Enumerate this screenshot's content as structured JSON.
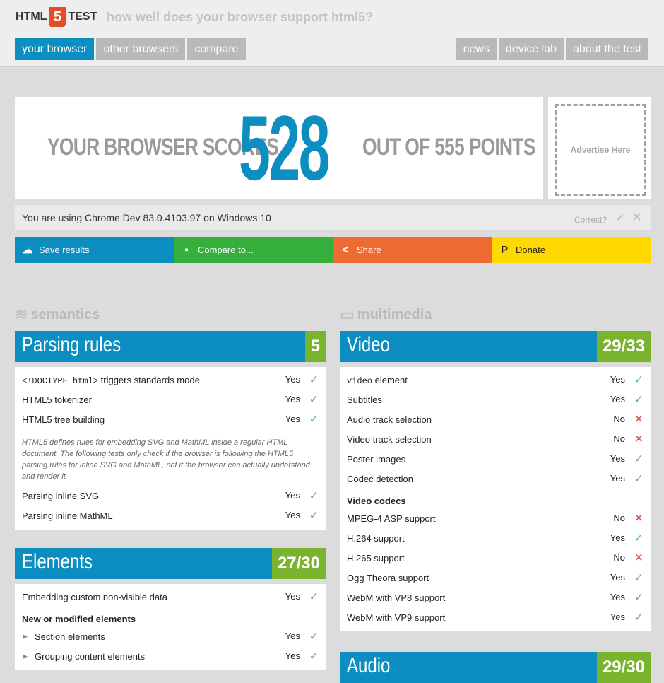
{
  "header": {
    "logo_pre": "HTML",
    "logo_num": "5",
    "logo_post": "TEST",
    "tagline": "how well does your browser support html5?",
    "nav_left": [
      "your browser",
      "other browsers",
      "compare"
    ],
    "nav_right": [
      "news",
      "device lab",
      "about the test"
    ]
  },
  "score": {
    "pre": "YOUR BROWSER SCORES",
    "value": "528",
    "post": "OUT OF 555 POINTS",
    "ad": "Advertise Here"
  },
  "using": {
    "text": "You are using Chrome Dev 83.0.4103.97 on Windows 10",
    "correct": "Correct?"
  },
  "actions": {
    "save": "Save results",
    "compare": "Compare to...",
    "share": "Share",
    "donate": "Donate"
  },
  "categories": {
    "semantics": "semantics",
    "multimedia": "multimedia"
  },
  "parsing": {
    "title": "Parsing rules",
    "points": "5",
    "rows": [
      {
        "pre_mono": "<!DOCTYPE html>",
        "label": " triggers standards mode",
        "val": "Yes"
      },
      {
        "label": "HTML5 tokenizer",
        "val": "Yes"
      },
      {
        "label": "HTML5 tree building",
        "val": "Yes"
      }
    ],
    "note": "HTML5 defines rules for embedding SVG and MathML inside a regular HTML document. The following tests only check if the browser is following the HTML5 parsing rules for inline SVG and MathML, not if the browser can actually understand and render it.",
    "rows2": [
      {
        "label": "Parsing inline SVG",
        "val": "Yes"
      },
      {
        "label": "Parsing inline MathML",
        "val": "Yes"
      }
    ]
  },
  "elements": {
    "title": "Elements",
    "points": "27/30",
    "row1": {
      "label": "Embedding custom non-visible data",
      "val": "Yes"
    },
    "subhead": "New or modified elements",
    "rows": [
      {
        "label": "Section elements",
        "val": "Yes"
      },
      {
        "label": "Grouping content elements",
        "val": "Yes"
      }
    ]
  },
  "video": {
    "title": "Video",
    "points": "29/33",
    "rows": [
      {
        "pre_mono": "video",
        "label": " element",
        "val": "Yes"
      },
      {
        "label": "Subtitles",
        "val": "Yes"
      },
      {
        "label": "Audio track selection",
        "val": "No"
      },
      {
        "label": "Video track selection",
        "val": "No"
      },
      {
        "label": "Poster images",
        "val": "Yes"
      },
      {
        "label": "Codec detection",
        "val": "Yes"
      }
    ],
    "subhead": "Video codecs",
    "codecs": [
      {
        "label": "MPEG-4 ASP support",
        "val": "No"
      },
      {
        "label": "H.264 support",
        "val": "Yes"
      },
      {
        "label": "H.265 support",
        "val": "No"
      },
      {
        "label": "Ogg Theora support",
        "val": "Yes"
      },
      {
        "label": "WebM with VP8 support",
        "val": "Yes"
      },
      {
        "label": "WebM with VP9 support",
        "val": "Yes"
      }
    ]
  },
  "audio": {
    "title": "Audio",
    "points": "29/30"
  }
}
